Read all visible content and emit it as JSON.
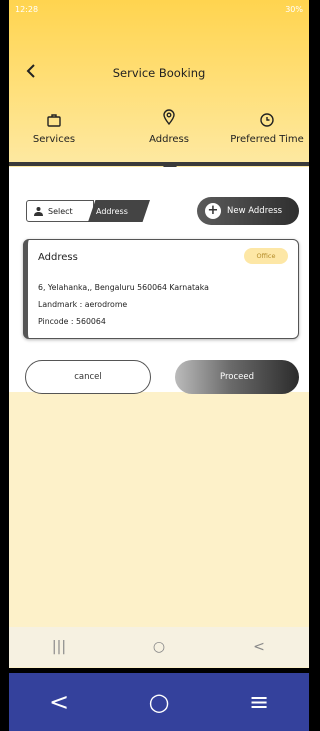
{
  "status_bar": {
    "time": "12:28",
    "right": "30%"
  },
  "header": {
    "title": "Service Booking",
    "back_icon": "chevron-left-icon"
  },
  "tabs": [
    {
      "label": "Services",
      "icon": "briefcase-icon"
    },
    {
      "label": "Address",
      "icon": "location-pin-icon",
      "active": true
    },
    {
      "label": "Preferred Time",
      "icon": "clock-icon"
    }
  ],
  "select_address": {
    "select_label": "Select",
    "address_label": "Address"
  },
  "new_address_button": "New Address",
  "address_card": {
    "title": "Address",
    "badge": "Office",
    "line1": "6, Yelahanka,, Bengaluru  560064 Karnataka",
    "line2": "Landmark : aerodrome",
    "line3": "Pincode :  560064"
  },
  "actions": {
    "cancel": "cancel",
    "proceed": "Proceed"
  },
  "system_nav": {
    "recents": "|||",
    "home": "○",
    "back": "<"
  },
  "bottom_nav": {
    "back": "<",
    "home": "○",
    "menu": "≡"
  },
  "colors": {
    "header": "#ffd44f",
    "background": "#fdf1c9",
    "bottom_bar": "#34419c",
    "dark": "#3a3a3a"
  }
}
